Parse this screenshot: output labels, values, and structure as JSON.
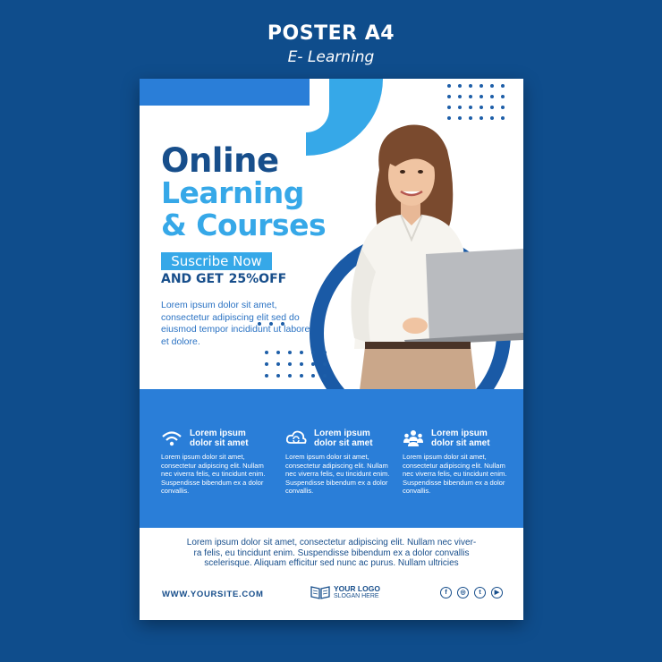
{
  "header": {
    "title": "POSTER A4",
    "subtitle": "E- Learning"
  },
  "poster": {
    "title_line1": "Online",
    "title_line2": "Learning",
    "title_line3": "& Courses",
    "subscribe_label": "Suscribe Now",
    "offer_prefix": "AND GET",
    "offer_value": "25%OFF",
    "intro_text": "Lorem ipsum dolor sit amet, consectetur adipiscing elit sed do eiusmod tempor incididunt ut labore et dolore.",
    "features": [
      {
        "icon": "wifi-icon",
        "title_line1": "Lorem ipsum",
        "title_line2": "dolor sit amet",
        "text": "Lorem ipsum dolor sit amet, consectetur adipiscing elit. Nullam nec viverra felis, eu tincidunt enim. Suspendisse bibendum ex a dolor convallis."
      },
      {
        "icon": "cloud-sync-icon",
        "title_line1": "Lorem ipsum",
        "title_line2": "dolor sit amet",
        "text": "Lorem ipsum dolor sit amet, consectetur adipiscing elit. Nullam nec viverra felis, eu tincidunt enim. Suspendisse bibendum ex a dolor convallis."
      },
      {
        "icon": "group-icon",
        "title_line1": "Lorem ipsum",
        "title_line2": "dolor sit amet",
        "text": "Lorem ipsum dolor sit amet, consectetur adipiscing elit. Nullam nec viverra felis, eu tincidunt enim. Suspendisse bibendum ex a dolor convallis."
      }
    ],
    "footer_line1": "Lorem ipsum dolor sit amet, consectetur adipiscing elit. Nullam nec viver-",
    "footer_line2": "ra felis, eu tincidunt enim. Suspendisse bibendum ex a dolor convallis",
    "footer_line3": "scelerisque. Aliquam efficitur sed nunc ac purus. Nullam ultricies",
    "website": "WWW.YOURSITE.COM",
    "logo_title": "YOUR LOGO",
    "logo_slogan": "SLOGAN HERE",
    "social": [
      {
        "icon": "facebook-icon",
        "glyph": "f"
      },
      {
        "icon": "instagram-icon",
        "glyph": "◎"
      },
      {
        "icon": "twitter-icon",
        "glyph": "t"
      },
      {
        "icon": "youtube-icon",
        "glyph": "▶"
      }
    ]
  },
  "colors": {
    "background": "#0f4d8c",
    "primary_dark": "#174e8b",
    "primary_light": "#36a8e8",
    "band": "#2a7ed8"
  }
}
